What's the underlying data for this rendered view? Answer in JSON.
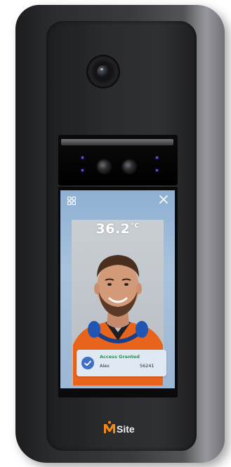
{
  "device": {
    "brand": "MSite",
    "colors": {
      "body": "#2b2c2f",
      "screen_accent": "#9cb7d3",
      "logo_orange": "#f08a1a",
      "access_green": "#1aa04a",
      "check_blue": "#3d6fc6"
    }
  },
  "screen": {
    "temperature": "36.2",
    "temperature_unit": "°C",
    "icons": {
      "top_left": "grid-icon",
      "top_right": "close-icon"
    },
    "toast": {
      "title": "Access Granted",
      "name": "Alex",
      "id": "56241",
      "icon": "check-circle-icon"
    }
  }
}
